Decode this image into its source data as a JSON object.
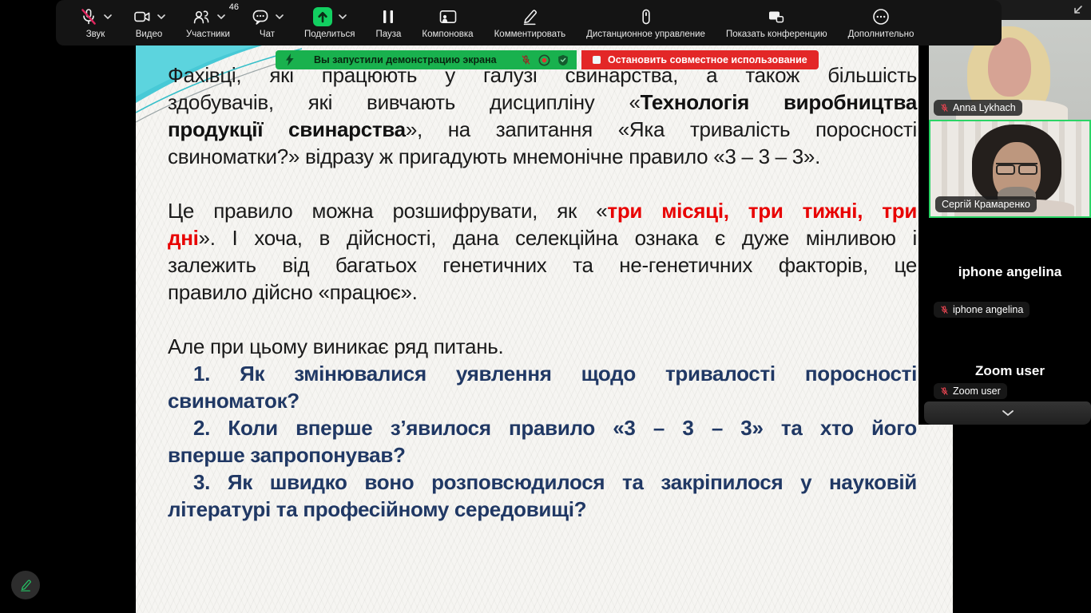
{
  "toolbar": {
    "items": [
      {
        "label": "Звук",
        "icon": "mic-muted-icon",
        "chevron": true
      },
      {
        "label": "Видео",
        "icon": "video-camera-icon",
        "chevron": true
      },
      {
        "label": "Участники",
        "icon": "participants-icon",
        "badge": "46",
        "chevron": true
      },
      {
        "label": "Чат",
        "icon": "chat-icon",
        "chevron": true
      },
      {
        "label": "Поделиться",
        "icon": "share-screen-icon",
        "chevron": true
      },
      {
        "label": "Пауза",
        "icon": "pause-icon"
      },
      {
        "label": "Компоновка",
        "icon": "layout-icon"
      },
      {
        "label": "Комментировать",
        "icon": "annotate-pencil-icon"
      },
      {
        "label": "Дистанционное управление",
        "icon": "remote-control-icon"
      },
      {
        "label": "Показать конференцию",
        "icon": "show-conference-icon"
      },
      {
        "label": "Дополнительно",
        "icon": "more-ellipsis-icon"
      }
    ]
  },
  "share_banner": {
    "message": "Вы запустили демонстрацию экрана",
    "stop_button": "Остановить совместное использование",
    "banner_green": "#19b14e",
    "stop_red": "#e32727"
  },
  "sidebar": {
    "participants": [
      {
        "name": "Anna Lykhach",
        "muted": true,
        "video": true
      },
      {
        "name": "Сергій Крамаренко",
        "muted": false,
        "video": true,
        "active_speaker": true
      },
      {
        "name": "iphone angelina",
        "muted": true,
        "video": false
      },
      {
        "name": "Zoom user",
        "muted": true,
        "video": false
      }
    ]
  },
  "slide": {
    "colors": {
      "text": "#1a1a1a",
      "red": "#e80000",
      "blue": "#203864",
      "background": "#f6f5f2",
      "accent_teal": "#3fc4d4"
    },
    "paragraphs": [
      {
        "gap_after": true,
        "lines": [
          {
            "segs": [
              {
                "t": "Фахівці, які працюють у галузі свинарства, а також більшість",
                "s": "n"
              }
            ]
          },
          {
            "segs": [
              {
                "t": "здобувачів, які вивчають дисципліну «",
                "s": "n"
              },
              {
                "t": "Технологія виробництва",
                "s": "b"
              }
            ]
          },
          {
            "segs": [
              {
                "t": "продукції свинарства",
                "s": "b"
              },
              {
                "t": "», на запитання «Яка тривалість поросності",
                "s": "n"
              }
            ]
          },
          {
            "segs": [
              {
                "t": "свиноматки?» відразу ж пригадують мнемонічне правило «3 – 3 – 3».",
                "s": "n"
              }
            ]
          }
        ]
      },
      {
        "gap_after": true,
        "lines": [
          {
            "segs": [
              {
                "t": "Це правило можна розшифрувати, як «",
                "s": "n"
              },
              {
                "t": "три місяці, три тижні, три",
                "s": "r"
              }
            ]
          },
          {
            "segs": [
              {
                "t": "дні",
                "s": "r"
              },
              {
                "t": "». І хоча, в дійсності, дана селекційна ознака є дуже мінливою і",
                "s": "n"
              }
            ]
          },
          {
            "segs": [
              {
                "t": "залежить від багатьох генетичних та не-генетичних факторів, це",
                "s": "n"
              }
            ]
          },
          {
            "segs": [
              {
                "t": "правило дійсно «працює».",
                "s": "n"
              }
            ]
          }
        ]
      },
      {
        "gap_after": false,
        "lines": [
          {
            "segs": [
              {
                "t": "Але при цьому виникає ряд питань.",
                "s": "n"
              }
            ]
          }
        ]
      },
      {
        "gap_after": false,
        "lines": [
          {
            "indent": true,
            "segs": [
              {
                "t": "1. Як змінювалися уявлення щодо тривалості поросності",
                "s": "u"
              }
            ]
          },
          {
            "segs": [
              {
                "t": "свиноматок?",
                "s": "u"
              }
            ]
          }
        ]
      },
      {
        "gap_after": false,
        "lines": [
          {
            "indent": true,
            "segs": [
              {
                "t": "2. Коли вперше з’явилося правило «3 – 3 – 3» та хто його",
                "s": "u"
              }
            ]
          },
          {
            "segs": [
              {
                "t": "вперше запропонував?",
                "s": "u"
              }
            ]
          }
        ]
      },
      {
        "gap_after": false,
        "lines": [
          {
            "indent": true,
            "segs": [
              {
                "t": "3. Як швидко воно розповсюдилося та закріпилося у науковій",
                "s": "u"
              }
            ]
          },
          {
            "segs": [
              {
                "t": "літературі та професійному середовищі?",
                "s": "u"
              }
            ]
          }
        ]
      }
    ]
  }
}
